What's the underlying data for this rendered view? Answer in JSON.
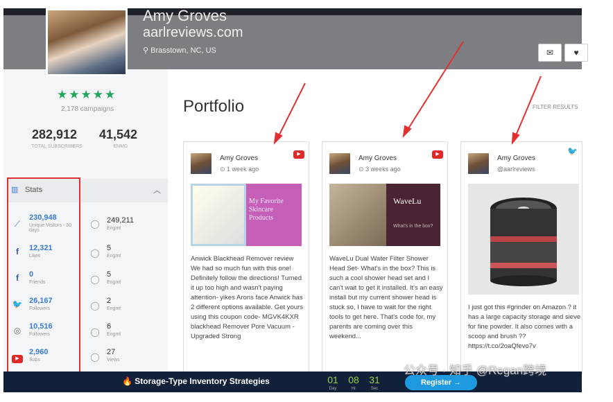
{
  "profile": {
    "name": "Amy Groves",
    "site": "aarlreviews.com",
    "location": "Brasstown, NC, US",
    "stars": "★★★★★",
    "campaigns": "2,178 campaigns",
    "total_subscribers": "282,912",
    "total_subscribers_label": "TOTAL SUBSCRIBERS",
    "engagement": "41,542",
    "engagement_label": "ENMG"
  },
  "stats": {
    "title": "Stats",
    "rows": [
      {
        "icon": "trend-icon",
        "value": "230,948",
        "label": "Unique Visitors - 30 days",
        "eng_value": "249,211",
        "eng_label": "Engmt"
      },
      {
        "icon": "facebook-icon",
        "value": "12,321",
        "label": "Likes",
        "eng_value": "5",
        "eng_label": "Engmt"
      },
      {
        "icon": "facebook-icon",
        "value": "0",
        "label": "Friends",
        "eng_value": "5",
        "eng_label": "Engmt"
      },
      {
        "icon": "twitter-icon",
        "value": "26,167",
        "label": "Followers",
        "eng_value": "2",
        "eng_label": "Engmt"
      },
      {
        "icon": "instagram-icon",
        "value": "10,516",
        "label": "Followers",
        "eng_value": "6",
        "eng_label": "Engmt"
      },
      {
        "icon": "youtube-icon",
        "value": "2,960",
        "label": "Subs",
        "eng_value": "27",
        "eng_label": "Views"
      }
    ]
  },
  "portfolio": {
    "title": "Portfolio",
    "filter": "FILTER RESULTS",
    "cards": [
      {
        "author": "Amy Groves",
        "time": "1 week ago",
        "platform": "youtube-icon",
        "image_text": "My Favorite Skincare Products",
        "body": "Anwick Blackhead Remover review We had so much fun with this one! Definitely follow the directions! Turned it up too high and wasn't paying attention- yikes Arons face Anwick has 2 different options available. Get yours using this coupon code- MGVK4KXR blackhead Remover Pore Vacuum - Upgraded Strong"
      },
      {
        "author": "Amy Groves",
        "time": "3 weeks ago",
        "platform": "youtube-icon",
        "image_text": "WaveLu",
        "image_sub": "What's in the box?",
        "body": "WaveLu Dual Water Filter Shower Head Set- What's in the box? This is such a cool shower head set and I can't wait to get it installed. It's an easy install but my current shower head is stuck so, I have to wait for the right tools to get here. That's code for, my parents are coming over this weekend..."
      },
      {
        "author": "Amy Groves",
        "time": "@aarlreviews",
        "platform": "twitter-icon",
        "body": "I just got this #grinder on Amazon ? it has a large capacity storage and sieve for fine powder. It also comes with a scoop and brush ?? https://t.co/2oaQfevo7v"
      }
    ]
  },
  "bottom_bar": {
    "promo": "Storage-Type Inventory Strategies",
    "countdown": [
      {
        "value": "01",
        "label": "Day"
      },
      {
        "value": "08",
        "label": "Hr"
      },
      {
        "value": "31",
        "label": "Sec"
      }
    ],
    "register": "Register →",
    "watermark": "公众号 · 知乎 @Regan跨境"
  }
}
